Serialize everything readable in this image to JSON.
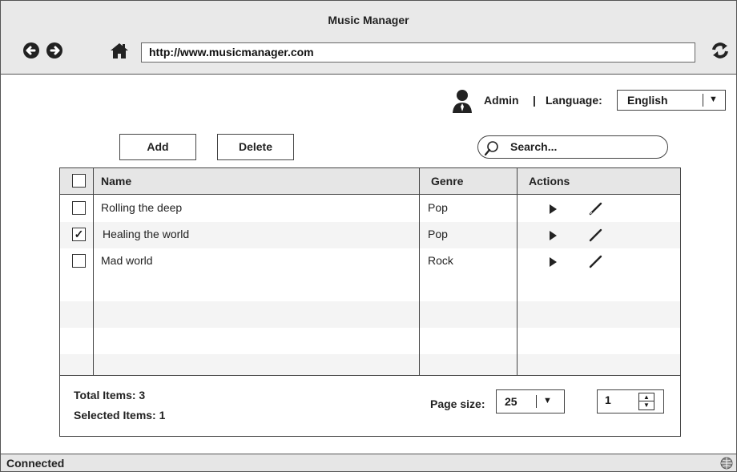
{
  "window": {
    "title": "Music Manager"
  },
  "toolbar": {
    "address": "http://www.musicmanager.com",
    "icons": [
      "back-icon",
      "forward-icon",
      "home-icon",
      "refresh-icon"
    ]
  },
  "header": {
    "user": "Admin",
    "separator": "|",
    "language_label": "Language:",
    "language_value": "English"
  },
  "actions": {
    "add_label": "Add",
    "delete_label": "Delete",
    "search_placeholder": "Search..."
  },
  "table": {
    "columns": [
      "Name",
      "Genre",
      "Actions"
    ],
    "rows": [
      {
        "checked": false,
        "name": "Rolling the deep",
        "genre": "Pop"
      },
      {
        "checked": true,
        "name": "Healing the world",
        "genre": "Pop"
      },
      {
        "checked": false,
        "name": "Mad world",
        "genre": "Rock"
      }
    ],
    "row_action_icons": [
      "play-icon",
      "edit-icon"
    ],
    "total_items": "Total Items: 3",
    "selected_items": "Selected Items: 1",
    "page_size_label": "Page size:",
    "page_size_value": "25",
    "page_number": "1"
  },
  "status": {
    "text": "Connected"
  },
  "colors": {
    "chrome": "#e9e9e9",
    "border": "#444444",
    "alt_row": "#f4f4f4"
  }
}
